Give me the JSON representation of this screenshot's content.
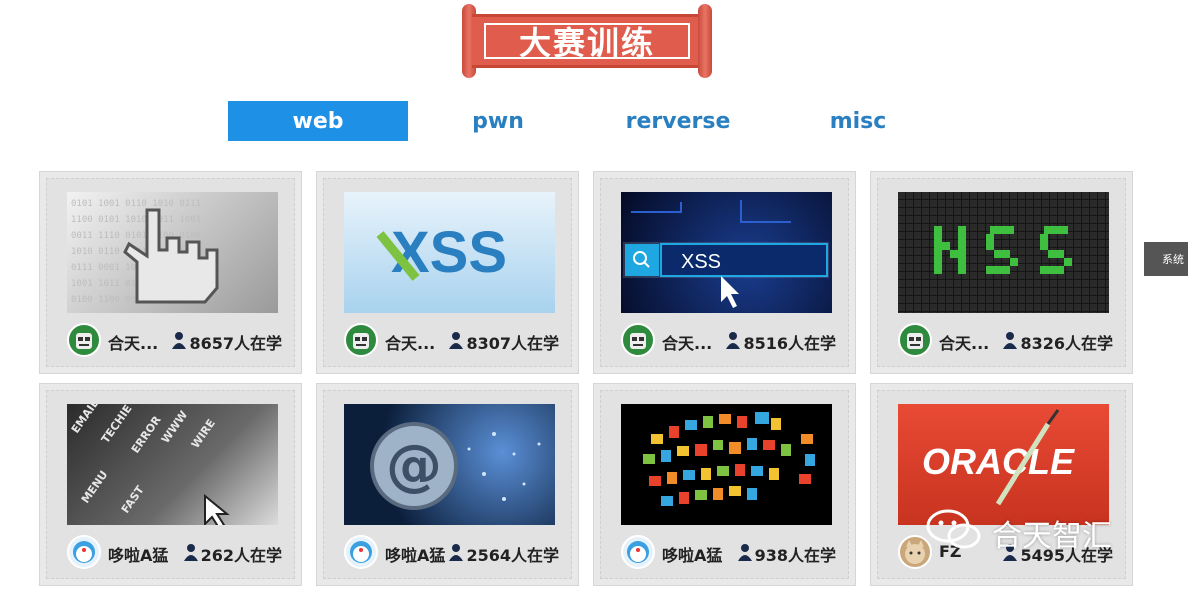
{
  "banner": {
    "title": "大赛训练"
  },
  "tabs": [
    {
      "label": "web",
      "active": true
    },
    {
      "label": "pwn",
      "active": false
    },
    {
      "label": "rerverse",
      "active": false
    },
    {
      "label": "misc",
      "active": false
    }
  ],
  "courses": [
    {
      "thumb": "hand-cursor-binary",
      "author": "合天...",
      "learners": "8657人在学",
      "avatar": "robot-avatar"
    },
    {
      "thumb": "xss-logo",
      "author": "合天...",
      "learners": "8307人在学",
      "avatar": "robot-avatar"
    },
    {
      "thumb": "xss-search-bar",
      "author": "合天...",
      "learners": "8516人在学",
      "avatar": "robot-avatar"
    },
    {
      "thumb": "xss-pixel-green",
      "author": "合天...",
      "learners": "8326人在学",
      "avatar": "robot-avatar"
    },
    {
      "thumb": "words-cursor",
      "author": "哆啦A猛",
      "learners": "262人在学",
      "avatar": "doraemon-avatar"
    },
    {
      "thumb": "at-sign-email",
      "author": "哆啦A猛",
      "learners": "2564人在学",
      "avatar": "doraemon-avatar"
    },
    {
      "thumb": "icons-speech-bubble",
      "author": "哆啦A猛",
      "learners": "938人在学",
      "avatar": "doraemon-avatar"
    },
    {
      "thumb": "oracle-syringe",
      "author": "FZ",
      "learners": "5495人在学",
      "avatar": "cat-avatar",
      "brand": "ORACLE"
    }
  ],
  "thumb_texts": {
    "xss": "XSS",
    "xss_search": "XSS"
  },
  "side_tab": {
    "label": "系统"
  },
  "watermark": {
    "text": "合天智汇"
  },
  "colors": {
    "accent": "#1e90e6",
    "tab_text": "#2a7fc0",
    "banner": "#e05c4c"
  }
}
